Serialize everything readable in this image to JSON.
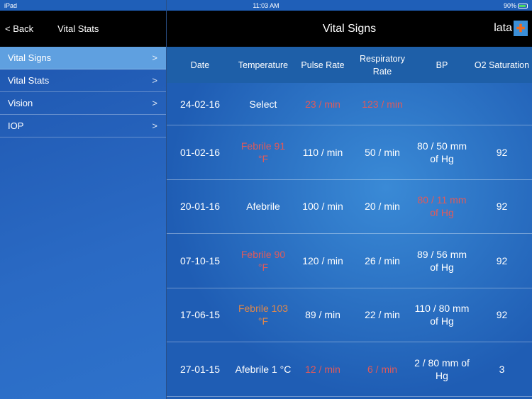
{
  "status_bar": {
    "device": "iPad",
    "time": "11:03 AM",
    "battery": "90%"
  },
  "sidebar": {
    "back_label": "< Back",
    "title": "Vital Stats",
    "items": [
      {
        "label": "Vital Signs",
        "active": true
      },
      {
        "label": "Vital Stats"
      },
      {
        "label": "Vision"
      },
      {
        "label": "IOP"
      }
    ]
  },
  "header": {
    "title": "Vital Signs",
    "user": "lata"
  },
  "colors": {
    "alert": "#e05a5a",
    "warn": "#e0884a",
    "selected": "#5fa0e0"
  },
  "table": {
    "columns": [
      "Date",
      "Temperature",
      "Pulse Rate",
      "Respiratory Rate",
      "BP",
      "O2 Saturation"
    ],
    "rows": [
      [
        {
          "text": "24-02-16"
        },
        {
          "text": "Select"
        },
        {
          "text": "23 / min",
          "status": "alert"
        },
        {
          "text": "123 / min",
          "status": "alert"
        },
        {
          "text": ""
        },
        {
          "text": ""
        }
      ],
      [
        {
          "text": "01-02-16"
        },
        {
          "text": "Febrile 91 °F",
          "status": "alert"
        },
        {
          "text": "110 / min"
        },
        {
          "text": "50 / min"
        },
        {
          "text": "80 / 50 mm of Hg"
        },
        {
          "text": "92"
        }
      ],
      [
        {
          "text": "20-01-16"
        },
        {
          "text": "Afebrile"
        },
        {
          "text": "100 / min"
        },
        {
          "text": "20 / min"
        },
        {
          "text": "80 / 11 mm of Hg",
          "status": "alert"
        },
        {
          "text": "92"
        }
      ],
      [
        {
          "text": "07-10-15"
        },
        {
          "text": "Febrile 90 °F",
          "status": "alert"
        },
        {
          "text": "120 / min"
        },
        {
          "text": "26 / min"
        },
        {
          "text": "89 / 56 mm of Hg"
        },
        {
          "text": "92"
        }
      ],
      [
        {
          "text": "17-06-15"
        },
        {
          "text": "Febrile 103 °F",
          "status": "warn"
        },
        {
          "text": "89 / min"
        },
        {
          "text": "22 / min"
        },
        {
          "text": "110 / 80 mm of Hg"
        },
        {
          "text": "92"
        }
      ],
      [
        {
          "text": "27-01-15"
        },
        {
          "text": "Afebrile 1 °C"
        },
        {
          "text": "12 / min",
          "status": "alert"
        },
        {
          "text": "6 / min",
          "status": "alert"
        },
        {
          "text": "2 / 80 mm of Hg"
        },
        {
          "text": "3"
        }
      ]
    ]
  }
}
